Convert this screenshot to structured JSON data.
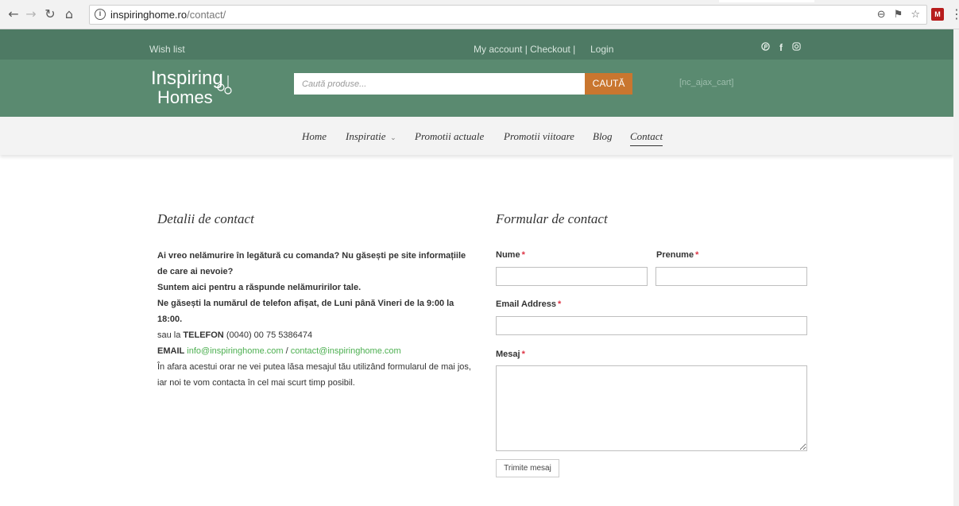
{
  "browser": {
    "url_host": "inspiringhome.ro",
    "url_path": "/contact/",
    "ext_label": "M"
  },
  "topbar": {
    "wish_list": "Wish list",
    "account_checkout": "My account | Checkout |",
    "login": "Login",
    "social_icons": [
      "pinterest-icon",
      "facebook-icon",
      "instagram-icon"
    ]
  },
  "header": {
    "logo_line1": "Inspiring",
    "logo_line2": "Homes",
    "search_placeholder": "Caută produse...",
    "search_button": "CAUTĂ",
    "cart_shortcode": "[nc_ajax_cart]"
  },
  "nav": {
    "items": [
      {
        "label": "Home"
      },
      {
        "label": "Inspiratie"
      },
      {
        "label": "Promotii actuale"
      },
      {
        "label": "Promotii viitoare"
      },
      {
        "label": "Blog"
      },
      {
        "label": "Contact"
      }
    ]
  },
  "details": {
    "title": "Detalii de contact",
    "bold1": "Ai vreo nelămurire în legătură cu comanda? Nu găsești pe site informațiile de care ai nevoie?",
    "bold2": "Suntem aici pentru a răspunde nelămuririlor tale.",
    "bold3": "Ne găsești la numărul de telefon afișat, de Luni până Vineri de la 9:00 la 18:00.",
    "phone_prefix": "sau la",
    "phone_label": "TELEFON",
    "phone_value": "(0040) 00 75 5386474",
    "email_label": "EMAIL",
    "email1": "info@inspiringhome.com",
    "email_sep": "/",
    "email2": "contact@inspiringhome.com",
    "footer_text": "În afara acestui orar ne vei putea lăsa mesajul tău utilizând formularul de mai jos, iar noi te vom contacta în cel mai scurt timp posibil."
  },
  "form": {
    "title": "Formular de contact",
    "nume_label": "Nume",
    "prenume_label": "Prenume",
    "email_label": "Email Address",
    "mesaj_label": "Mesaj",
    "required_mark": "*",
    "submit": "Trimite mesaj"
  },
  "colors": {
    "header_green": "#5a8a70",
    "search_orange": "#c9762f",
    "link_green": "#4caf50"
  }
}
